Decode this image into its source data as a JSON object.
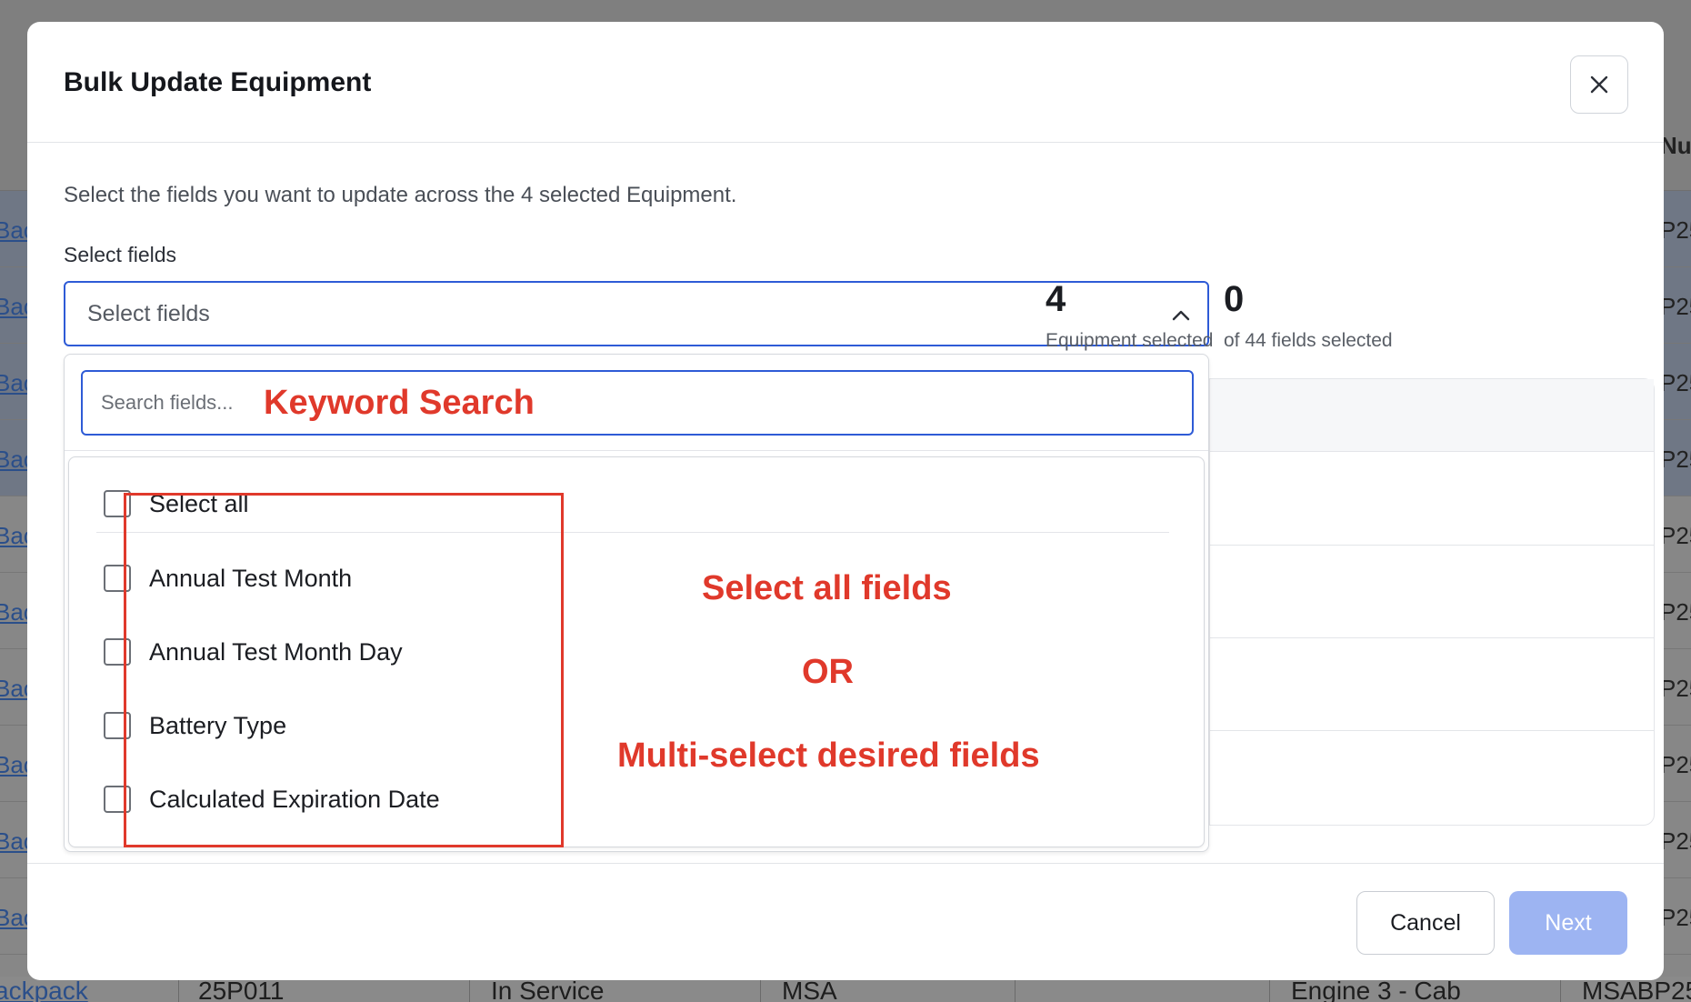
{
  "background": {
    "link_fragment": "Bac",
    "right_fragment": "P25",
    "col_header_fragment": "Nu",
    "bottom_row": {
      "link": "ackpack",
      "id": "25P011",
      "status": "In Service",
      "maker": "MSA",
      "location": "Engine 3 - Cab",
      "serial": "MSABP25"
    }
  },
  "modal": {
    "title": "Bulk Update Equipment",
    "intro": "Select the fields you want to update across the 4 selected Equipment.",
    "select_label": "Select fields",
    "select_placeholder": "Select fields",
    "stats": {
      "equipment_count": "4",
      "equipment_label": "Equipment selected",
      "fields_count": "0",
      "fields_label": "of 44 fields selected"
    },
    "dropdown": {
      "search_placeholder": "Search fields...",
      "options": [
        {
          "label": "Select all",
          "checked": false
        },
        {
          "label": "Annual Test Month",
          "checked": false
        },
        {
          "label": "Annual Test Month Day",
          "checked": false
        },
        {
          "label": "Battery Type",
          "checked": false
        },
        {
          "label": "Calculated Expiration Date",
          "checked": false
        }
      ]
    },
    "footer": {
      "cancel_label": "Cancel",
      "next_label": "Next"
    }
  },
  "annotations": {
    "keyword_search": "Keyword Search",
    "select_all_fields": "Select all fields",
    "or": "OR",
    "multi_select": "Multi-select desired fields",
    "color": "#e0392b"
  },
  "colors": {
    "accent": "#2e5bd6",
    "next_disabled": "#9db4f2"
  }
}
